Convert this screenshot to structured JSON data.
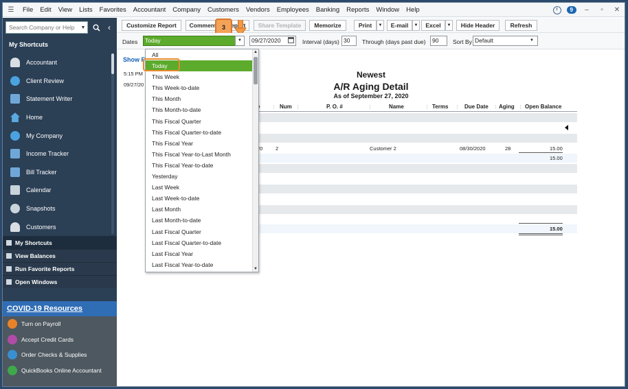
{
  "menubar": {
    "items": [
      "File",
      "Edit",
      "View",
      "Lists",
      "Favorites",
      "Accountant",
      "Company",
      "Customers",
      "Vendors",
      "Employees",
      "Banking",
      "Reports",
      "Window",
      "Help"
    ],
    "notification_count": "9"
  },
  "sidebar": {
    "search_placeholder": "Search Company or Help",
    "shortcuts_title": "My Shortcuts",
    "shortcuts": [
      {
        "label": "Accountant",
        "icon": "accountant-icon"
      },
      {
        "label": "Client Review",
        "icon": "client-review-icon"
      },
      {
        "label": "Statement Writer",
        "icon": "statement-writer-icon"
      },
      {
        "label": "Home",
        "icon": "home-icon"
      },
      {
        "label": "My Company",
        "icon": "my-company-icon"
      },
      {
        "label": "Income Tracker",
        "icon": "income-tracker-icon"
      },
      {
        "label": "Bill Tracker",
        "icon": "bill-tracker-icon"
      },
      {
        "label": "Calendar",
        "icon": "calendar-icon"
      },
      {
        "label": "Snapshots",
        "icon": "snapshots-icon"
      },
      {
        "label": "Customers",
        "icon": "customers-icon"
      }
    ],
    "sections": [
      "My Shortcuts",
      "View Balances",
      "Run Favorite Reports",
      "Open Windows"
    ],
    "covid": {
      "title": "COVID-19 Resources",
      "items": [
        {
          "label": "Turn on Payroll",
          "icon": "payroll-icon",
          "color": "#e8832a"
        },
        {
          "label": "Accept Credit Cards",
          "icon": "credit-card-icon",
          "color": "#b04ca8"
        },
        {
          "label": "Order Checks & Supplies",
          "icon": "checks-icon",
          "color": "#3a8fd0"
        },
        {
          "label": "QuickBooks Online Accountant",
          "icon": "plus-icon",
          "color": "#3ea84a"
        }
      ]
    }
  },
  "toolbar": {
    "customize_report": "Customize Report",
    "comment_on_report": "Comment on Report",
    "share_template": "Share Template",
    "memorize": "Memorize",
    "print": "Print",
    "email": "E-mail",
    "excel": "Excel",
    "hide_header": "Hide Header",
    "refresh": "Refresh",
    "step_badge": "3"
  },
  "filters": {
    "dates_label": "Dates",
    "dates_value": "Today",
    "date_value": "09/27/2020",
    "interval_label": "Interval (days)",
    "interval_value": "30",
    "through_label": "Through (days past due)",
    "through_value": "90",
    "sort_by_label": "Sort By",
    "sort_by_value": "Default"
  },
  "report": {
    "show_filters": "Show F",
    "time": "5:15 PM",
    "date": "09/27/20",
    "company": "Newest",
    "title": "A/R Aging Detail",
    "as_of": "As of September 27, 2020",
    "columns": [
      "e",
      "Num",
      "P. O. #",
      "Name",
      "Terms",
      "Due Date",
      "Aging",
      "Open Balance"
    ],
    "row": {
      "date_tail": "20",
      "num": "2",
      "name": "Customer 2",
      "due_date": "08/30/2020",
      "aging": "28",
      "open_balance": "15.00"
    },
    "subtotal": "15.00",
    "total": "15.00"
  },
  "date_menu": {
    "options": [
      "All",
      "Today",
      "This Week",
      "This Week-to-date",
      "This Month",
      "This Month-to-date",
      "This Fiscal Quarter",
      "This Fiscal Quarter-to-date",
      "This Fiscal Year",
      "This Fiscal Year-to-Last Month",
      "This Fiscal Year-to-date",
      "Yesterday",
      "Last Week",
      "Last Week-to-date",
      "Last Month",
      "Last Month-to-date",
      "Last Fiscal Quarter",
      "Last Fiscal Quarter-to-date",
      "Last Fiscal Year",
      "Last Fiscal Year-to-date"
    ],
    "selected": "Today"
  }
}
